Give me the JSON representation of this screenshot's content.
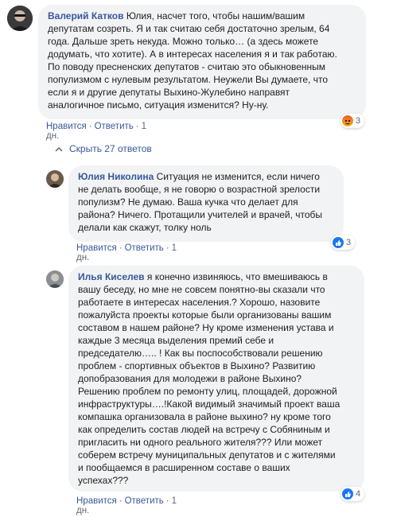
{
  "comments": [
    {
      "author": "Валерий Катков",
      "lines": [
        " Юлия, насчет того, чтобы нашим/вашим",
        "депутатам созреть. Я и так считаю себя достаточно зрелым, 64",
        "года. Дальше зреть некуда. Можно только… (а здесь можете",
        "додумать, что хотите). А в интересах населения я и так работаю.",
        "По поводу пресненских депутатов - считаю это обыкновенным",
        "популизмом с нулевым результатом. Неужели Вы думаете, что",
        "если я и другие депутаты Выхино-Жулебино направят",
        "аналогичное письмо, ситуация изменится? Ну-ну."
      ],
      "like": "Нравится",
      "reply": "Ответить",
      "time": "1 дн.",
      "reaction_count": "3",
      "reaction_icon": "angry-icon"
    },
    {
      "author": "Юлия Николина",
      "lines": [
        " Ситуация не изменится, если ничего",
        "не делать вообще, я не говорю о возрастной зрелости",
        "популизм? Не думаю. Ваша кучка что делает для",
        "района? Ничего. Протащили учителей и врачей, чтобы",
        "делали как скажут, толку ноль"
      ],
      "like": "Нравится",
      "reply": "Ответить",
      "time": "1 дн.",
      "reaction_count": "3",
      "reaction_icon": "like-icon"
    },
    {
      "author": "Илья Киселев",
      "lines": [
        " я конечно извиняюсь, что вмешиваюсь в",
        "вашу беседу, но мне не совсем понятно-вы сказали что",
        "работаете в интересах населения.? Хорошо, назовите",
        "пожалуйста проекты которые были организованы вашим",
        "составом в нашем районе? Ну кроме изменения устава и",
        "каждые 3 месяца выделения премий себе и",
        "председателю….. ! Как вы поспособствовали решению",
        "проблем - спортивных объектов в Выхино? Развитию",
        "допобразования для молодежи в районе Выхино?",
        "Решению проблем по ремонту улиц, площадей, дорожной",
        "инфраструктуры….!Какой видимый значимый проект ваша",
        "компашка организовала в районе выхино? ну кроме того",
        "как определить состав людей на встречу с Собяниным и",
        "пригласить ни одного реального жителя??? Или может",
        "соберем встречу муниципальных депутатов и с жителями",
        "и пообщаемся в расширенном составе о ваших",
        "успехах???"
      ],
      "like": "Нравится",
      "reply": "Ответить",
      "time": "1 дн.",
      "reaction_count": "4",
      "reaction_icon": "like-icon"
    }
  ],
  "hide_replies_label": "Скрыть 27 ответов"
}
